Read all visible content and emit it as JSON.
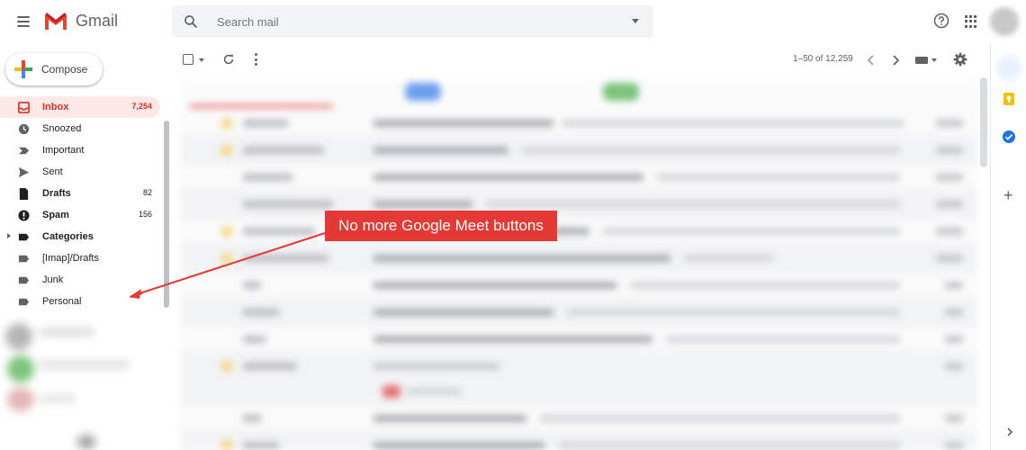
{
  "header": {
    "app_name": "Gmail",
    "search_placeholder": "Search mail",
    "icons": [
      "menu-icon",
      "gmail-logo",
      "search-icon",
      "help-icon",
      "apps-icon"
    ]
  },
  "compose": {
    "label": "Compose"
  },
  "sidebar": {
    "items": [
      {
        "label": "Inbox",
        "count": "7,254",
        "icon": "inbox-icon",
        "active": true
      },
      {
        "label": "Snoozed",
        "count": "",
        "icon": "clock-icon"
      },
      {
        "label": "Important",
        "count": "",
        "icon": "important-icon"
      },
      {
        "label": "Sent",
        "count": "",
        "icon": "send-icon"
      },
      {
        "label": "Drafts",
        "count": "82",
        "icon": "draft-icon",
        "bold": true
      },
      {
        "label": "Spam",
        "count": "156",
        "icon": "spam-icon",
        "bold": true
      },
      {
        "label": "Categories",
        "count": "",
        "icon": "label-icon",
        "bold": true
      },
      {
        "label": "[Imap]/Drafts",
        "count": "",
        "icon": "label-icon"
      },
      {
        "label": "Junk",
        "count": "",
        "icon": "label-icon"
      },
      {
        "label": "Personal",
        "count": "",
        "icon": "label-icon"
      }
    ]
  },
  "toolbar": {
    "pagination": "1–50 of 12,259",
    "icons": [
      "checkbox-icon",
      "refresh-icon",
      "more-vert-icon",
      "chevron-left-icon",
      "chevron-right-icon",
      "keyboard-icon",
      "settings-icon"
    ]
  },
  "annotation": {
    "text": "No more Google Meet buttons",
    "color": "#e53935"
  },
  "colors": {
    "accent_red": "#d93025",
    "active_bg": "#fce8e6",
    "search_bg": "#f1f3f4"
  }
}
